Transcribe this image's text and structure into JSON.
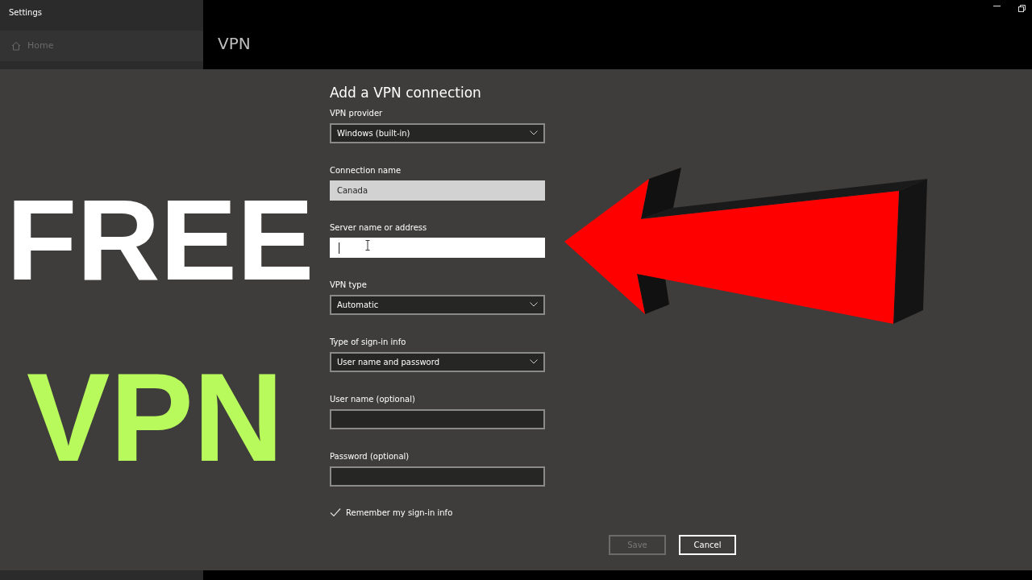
{
  "window": {
    "title": "Settings"
  },
  "sidebar": {
    "items": [
      {
        "label": "Home"
      }
    ]
  },
  "page": {
    "title": "VPN"
  },
  "dialog": {
    "title": "Add a VPN connection",
    "fields": [
      {
        "kind": "dropdown",
        "label": "VPN provider",
        "value": "Windows (built-in)"
      },
      {
        "kind": "text",
        "label": "Connection name",
        "value": "Canada",
        "focused": false,
        "hovered": true
      },
      {
        "kind": "text",
        "label": "Server name or address",
        "focused": true,
        "hovered": false
      },
      {
        "kind": "dropdown",
        "label": "VPN type",
        "value": "Automatic"
      },
      {
        "kind": "dropdown",
        "label": "Type of sign-in info",
        "value": "User name and password"
      },
      {
        "kind": "text",
        "label": "User name (optional)",
        "focused": false,
        "hovered": false
      },
      {
        "kind": "text",
        "label": "Password (optional)",
        "focused": false,
        "hovered": false
      }
    ],
    "checkbox": {
      "label": "Remember my sign-in info",
      "checked": true
    },
    "buttons": [
      {
        "label": "Save",
        "disabled": true
      },
      {
        "label": "Cancel",
        "disabled": false
      }
    ]
  },
  "overlay_text": [
    {
      "text": "FREE",
      "color": "#ffffff"
    },
    {
      "text": "VPN",
      "color": "#b8fa5c"
    }
  ]
}
